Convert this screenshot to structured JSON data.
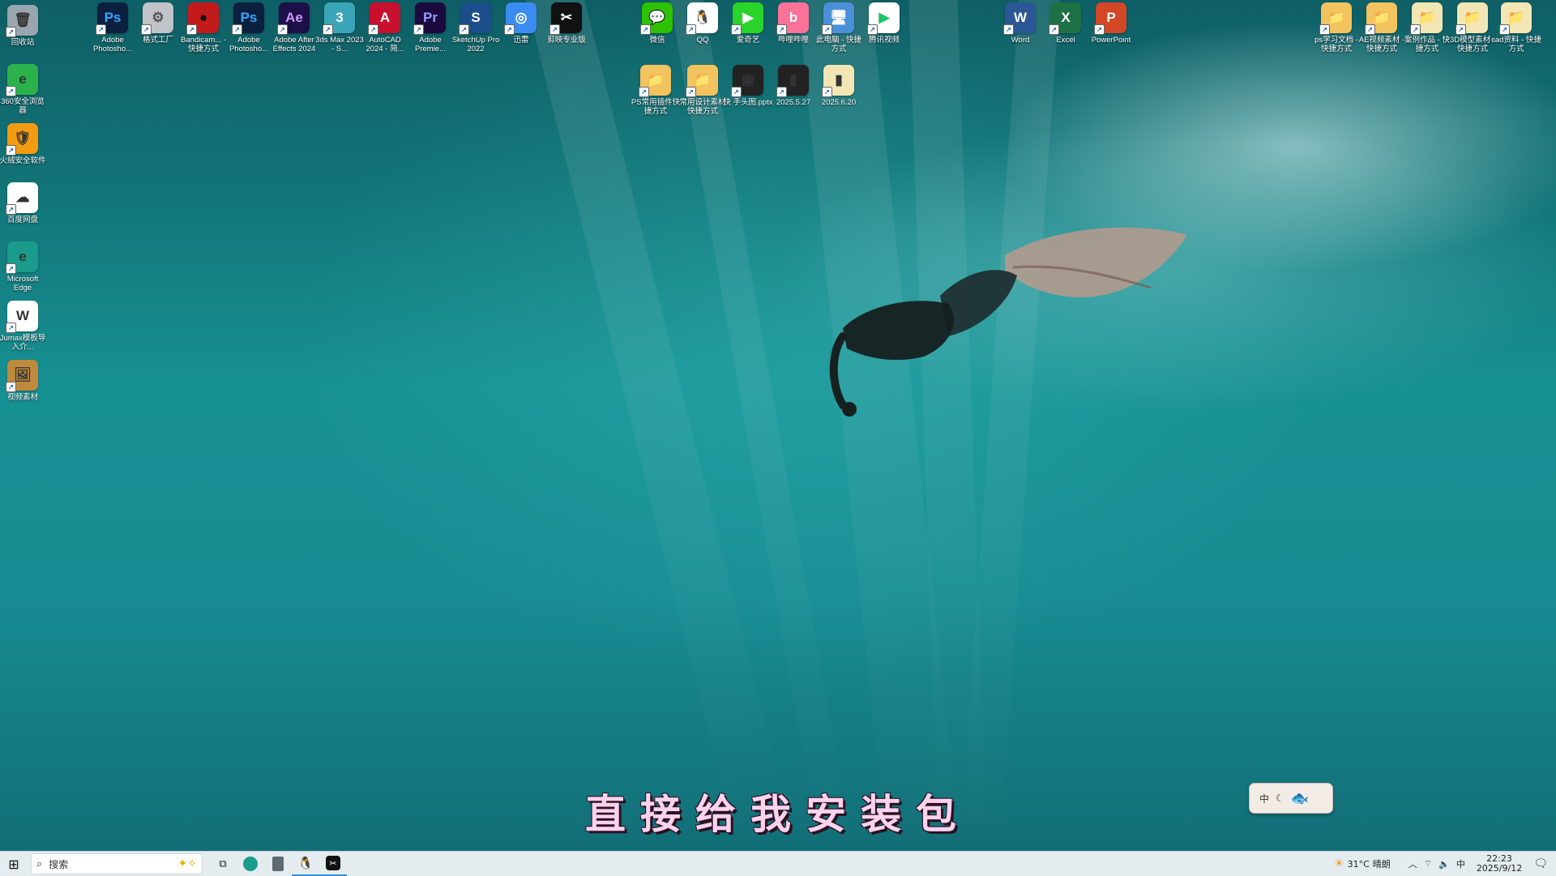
{
  "desktop": {
    "left_icons": [
      {
        "name": "recycle-bin-icon",
        "label": "回收站",
        "color": "#9aa6ad",
        "glyph": "🗑"
      },
      {
        "name": "browser-360-icon",
        "label": "360安全浏览器",
        "color": "#2bb24c",
        "glyph": "e"
      },
      {
        "name": "huorong-icon",
        "label": "火绒安全软件",
        "color": "#f39c12",
        "glyph": "🛡"
      },
      {
        "name": "baidu-netdisk-icon",
        "label": "百度网盘",
        "color": "#ffffff",
        "glyph": "☁"
      },
      {
        "name": "edge-icon",
        "label": "Microsoft Edge",
        "color": "#1a9c8c",
        "glyph": "e"
      },
      {
        "name": "word-doc-icon",
        "label": "Jumax模板导入介...",
        "color": "#ffffff",
        "glyph": "W"
      },
      {
        "name": "folder-icon",
        "label": "视频素材",
        "color": "#c08a3c",
        "glyph": "🖼"
      }
    ],
    "top_icons": [
      {
        "name": "photoshop-icon",
        "label": "Adobe Photosho...",
        "color": "#0b1f3f",
        "glyph": "Ps",
        "fg": "#31a8ff"
      },
      {
        "name": "format-factory-icon",
        "label": "格式工厂",
        "color": "#c0c4c8",
        "glyph": "⚙",
        "fg": "#555"
      },
      {
        "name": "bandicam-icon",
        "label": "Bandicam... - 快捷方式",
        "color": "#c31b1b",
        "glyph": "●",
        "fg": "#111"
      },
      {
        "name": "photoshop2-icon",
        "label": "Adobe Photosho...",
        "color": "#0b1f3f",
        "glyph": "Ps",
        "fg": "#31a8ff"
      },
      {
        "name": "after-effects-icon",
        "label": "Adobe After Effects 2024",
        "color": "#1d0f48",
        "glyph": "Ae",
        "fg": "#cf96fd"
      },
      {
        "name": "3dsmax-icon",
        "label": "3ds Max 2023 - S...",
        "color": "#3aa5b8",
        "glyph": "3",
        "fg": "#fff"
      },
      {
        "name": "autocad-icon",
        "label": "AutoCAD 2024 - 简...",
        "color": "#c8102e",
        "glyph": "A",
        "fg": "#fff"
      },
      {
        "name": "premiere-icon",
        "label": "Adobe Premie...",
        "color": "#1a0a3d",
        "glyph": "Pr",
        "fg": "#9999ff"
      },
      {
        "name": "sketchup-icon",
        "label": "SketchUp Pro 2022",
        "color": "#1b4e8a",
        "glyph": "S",
        "fg": "#fff"
      },
      {
        "name": "app-blue-icon",
        "label": "迅雷",
        "color": "#3b8cf0",
        "glyph": "◎",
        "fg": "#fff"
      },
      {
        "name": "capcut-icon",
        "label": "剪映专业版",
        "color": "#111111",
        "glyph": "✂",
        "fg": "#fff"
      },
      {
        "name": "wechat-icon",
        "label": "微信",
        "color": "#2dc100",
        "glyph": "💬",
        "fg": "#fff"
      },
      {
        "name": "qq-icon",
        "label": "QQ",
        "color": "#ffffff",
        "glyph": "🐧",
        "fg": "#000"
      },
      {
        "name": "iqiyi-icon",
        "label": "爱奇艺",
        "color": "#2bd42b",
        "glyph": "▶",
        "fg": "#fff"
      },
      {
        "name": "bilibili-icon",
        "label": "哔哩哔哩",
        "color": "#fb7299",
        "glyph": "b",
        "fg": "#fff"
      },
      {
        "name": "computer-icon",
        "label": "此电脑 - 快捷方式",
        "color": "#4a90d9",
        "glyph": "🖥",
        "fg": "#fff"
      },
      {
        "name": "tencent-video-icon",
        "label": "腾讯视频",
        "color": "#ffffff",
        "glyph": "▶",
        "fg": "#1ec26a"
      }
    ],
    "second_row": [
      {
        "name": "folder-ps-icon",
        "label": "PS常用插件快捷方式",
        "color": "#f2c35e",
        "glyph": "📁"
      },
      {
        "name": "folder-design-icon",
        "label": "常用设计素材快捷方式",
        "color": "#f2c35e",
        "glyph": "📁"
      },
      {
        "name": "pptx-icon",
        "label": "快 手头图.pptx",
        "color": "#222222",
        "glyph": "▣"
      },
      {
        "name": "zip-icon",
        "label": "2025.5.27",
        "color": "#222222",
        "glyph": "▮"
      },
      {
        "name": "folder-zip-icon",
        "label": "2025.6.20",
        "color": "#f2e7b4",
        "glyph": "▮"
      }
    ],
    "office_icons": [
      {
        "name": "word-icon",
        "label": "Word",
        "color": "#2b5797",
        "glyph": "W",
        "fg": "#fff"
      },
      {
        "name": "excel-icon",
        "label": "Excel",
        "color": "#1e7145",
        "glyph": "X",
        "fg": "#fff"
      },
      {
        "name": "powerpoint-icon",
        "label": "PowerPoint",
        "color": "#d24726",
        "glyph": "P",
        "fg": "#fff"
      }
    ],
    "right_icons": [
      {
        "name": "folder-right1-icon",
        "label": "ps学习文档 - 快捷方式",
        "color": "#f2c35e",
        "glyph": "📁"
      },
      {
        "name": "folder-right2-icon",
        "label": "AE视频素材 - 快捷方式",
        "color": "#f2c35e",
        "glyph": "📁"
      },
      {
        "name": "folder-right3-icon",
        "label": "案例作品 - 快捷方式",
        "color": "#f2e7b4",
        "glyph": "📁"
      },
      {
        "name": "folder-right4-icon",
        "label": "3D模型素材 - 快捷方式",
        "color": "#f2e7b4",
        "glyph": "📁"
      },
      {
        "name": "folder-right5-icon",
        "label": "cad资料 - 快捷方式",
        "color": "#f2e7b4",
        "glyph": "📁"
      }
    ]
  },
  "subtitle": "直接给我安装包",
  "ime": {
    "lang": "中",
    "mode": "☾"
  },
  "taskbar": {
    "start_glyph": "⊞",
    "search_placeholder": "搜索",
    "weather_temp": "31°C",
    "weather_desc": "晴朗",
    "time": "22:23",
    "date": "2025/9/12"
  }
}
